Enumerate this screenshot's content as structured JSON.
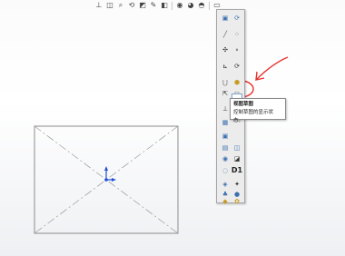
{
  "toolbar": {
    "icons": [
      "view-orientation-icon",
      "zoom-fit-icon",
      "zoom-area-icon",
      "previous-view-icon",
      "section-view-icon",
      "dynamic-annotation-icon",
      "display-style-icon",
      "hide-show-icon",
      "edit-appearance-icon",
      "apply-scene-icon",
      "view-settings-icon",
      "screen-capture-icon"
    ]
  },
  "panel": {
    "d1_label": "D1"
  },
  "tooltip": {
    "title": "视图草图",
    "description": "控制草图的显示状态。"
  },
  "colors": {
    "annotation_red": "#e8322d",
    "origin_blue": "#1f4fd8",
    "frame": "#8c8c8c"
  }
}
